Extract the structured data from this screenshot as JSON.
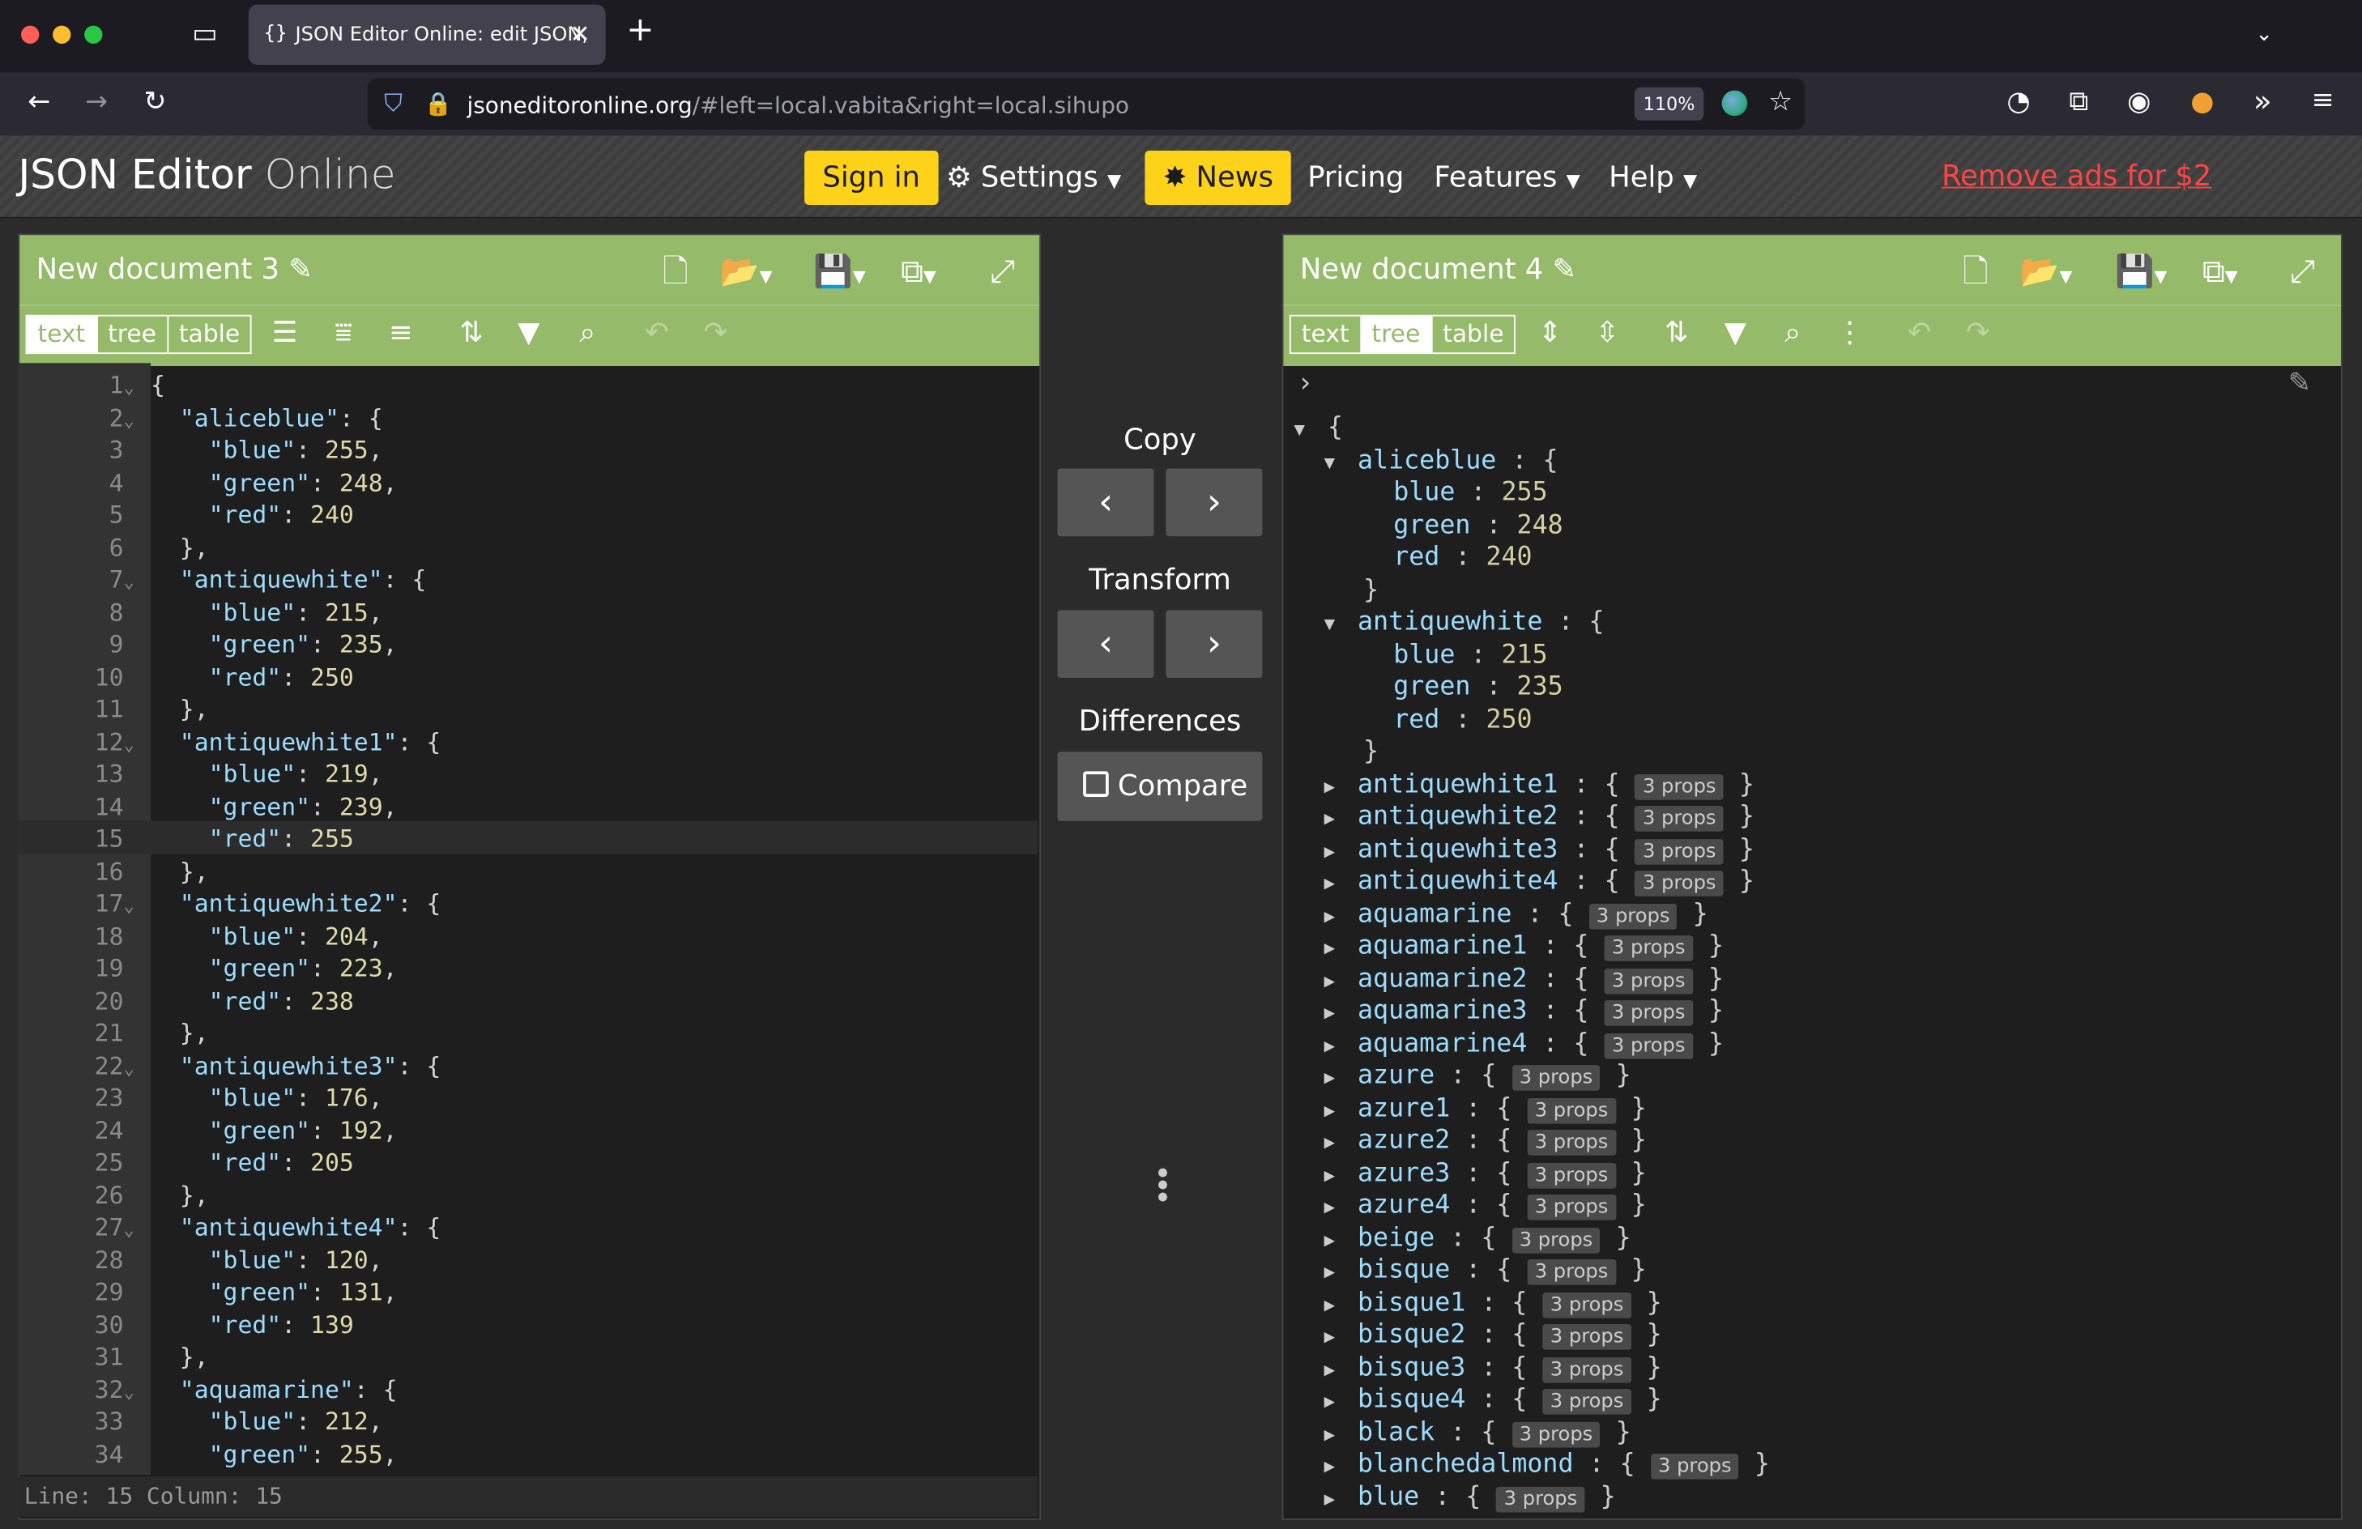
{
  "browser": {
    "tab_title": "JSON Editor Online: edit JSON,",
    "url_main": "jsoneditoronline.org",
    "url_rest": "/#left=local.vabita&right=local.sihupo",
    "zoom": "110%"
  },
  "header": {
    "logo_main": "JSON Editor",
    "logo_sub": "Online",
    "sign_in": "Sign in",
    "settings": "Settings",
    "news": "News",
    "pricing": "Pricing",
    "features": "Features",
    "help": "Help",
    "remove_ads": "Remove ads for $2"
  },
  "left_panel": {
    "title": "New document 3",
    "modes": [
      "text",
      "tree",
      "table"
    ],
    "active_mode": "text",
    "status": "Line: 15  Column: 15",
    "lines": [
      {
        "n": "1",
        "ind": 0,
        "open": "{",
        "fold": true
      },
      {
        "n": "2",
        "ind": 1,
        "key": "aliceblue",
        "open": "{",
        "fold": true
      },
      {
        "n": "3",
        "ind": 2,
        "key": "blue",
        "val": "255",
        "comma": true
      },
      {
        "n": "4",
        "ind": 2,
        "key": "green",
        "val": "248",
        "comma": true
      },
      {
        "n": "5",
        "ind": 2,
        "key": "red",
        "val": "240"
      },
      {
        "n": "6",
        "ind": 1,
        "close": "},"
      },
      {
        "n": "7",
        "ind": 1,
        "key": "antiquewhite",
        "open": "{",
        "fold": true
      },
      {
        "n": "8",
        "ind": 2,
        "key": "blue",
        "val": "215",
        "comma": true
      },
      {
        "n": "9",
        "ind": 2,
        "key": "green",
        "val": "235",
        "comma": true
      },
      {
        "n": "10",
        "ind": 2,
        "key": "red",
        "val": "250"
      },
      {
        "n": "11",
        "ind": 1,
        "close": "},"
      },
      {
        "n": "12",
        "ind": 1,
        "key": "antiquewhite1",
        "open": "{",
        "fold": true
      },
      {
        "n": "13",
        "ind": 2,
        "key": "blue",
        "val": "219",
        "comma": true
      },
      {
        "n": "14",
        "ind": 2,
        "key": "green",
        "val": "239",
        "comma": true
      },
      {
        "n": "15",
        "ind": 2,
        "key": "red",
        "val": "255",
        "active": true
      },
      {
        "n": "16",
        "ind": 1,
        "close": "},"
      },
      {
        "n": "17",
        "ind": 1,
        "key": "antiquewhite2",
        "open": "{",
        "fold": true
      },
      {
        "n": "18",
        "ind": 2,
        "key": "blue",
        "val": "204",
        "comma": true
      },
      {
        "n": "19",
        "ind": 2,
        "key": "green",
        "val": "223",
        "comma": true
      },
      {
        "n": "20",
        "ind": 2,
        "key": "red",
        "val": "238"
      },
      {
        "n": "21",
        "ind": 1,
        "close": "},"
      },
      {
        "n": "22",
        "ind": 1,
        "key": "antiquewhite3",
        "open": "{",
        "fold": true
      },
      {
        "n": "23",
        "ind": 2,
        "key": "blue",
        "val": "176",
        "comma": true
      },
      {
        "n": "24",
        "ind": 2,
        "key": "green",
        "val": "192",
        "comma": true
      },
      {
        "n": "25",
        "ind": 2,
        "key": "red",
        "val": "205"
      },
      {
        "n": "26",
        "ind": 1,
        "close": "},"
      },
      {
        "n": "27",
        "ind": 1,
        "key": "antiquewhite4",
        "open": "{",
        "fold": true
      },
      {
        "n": "28",
        "ind": 2,
        "key": "blue",
        "val": "120",
        "comma": true
      },
      {
        "n": "29",
        "ind": 2,
        "key": "green",
        "val": "131",
        "comma": true
      },
      {
        "n": "30",
        "ind": 2,
        "key": "red",
        "val": "139"
      },
      {
        "n": "31",
        "ind": 1,
        "close": "},"
      },
      {
        "n": "32",
        "ind": 1,
        "key": "aquamarine",
        "open": "{",
        "fold": true
      },
      {
        "n": "33",
        "ind": 2,
        "key": "blue",
        "val": "212",
        "comma": true
      },
      {
        "n": "34",
        "ind": 2,
        "key": "green",
        "val": "255",
        "comma": true
      }
    ]
  },
  "middle": {
    "copy": "Copy",
    "transform": "Transform",
    "differences": "Differences",
    "compare": "Compare"
  },
  "right_panel": {
    "title": "New document 4",
    "modes": [
      "text",
      "tree",
      "table"
    ],
    "active_mode": "tree",
    "expanded": [
      {
        "key": "aliceblue",
        "props": [
          [
            "blue",
            "255"
          ],
          [
            "green",
            "248"
          ],
          [
            "red",
            "240"
          ]
        ]
      },
      {
        "key": "antiquewhite",
        "props": [
          [
            "blue",
            "215"
          ],
          [
            "green",
            "235"
          ],
          [
            "red",
            "250"
          ]
        ]
      }
    ],
    "collapsed": [
      "antiquewhite1",
      "antiquewhite2",
      "antiquewhite3",
      "antiquewhite4",
      "aquamarine",
      "aquamarine1",
      "aquamarine2",
      "aquamarine3",
      "aquamarine4",
      "azure",
      "azure1",
      "azure2",
      "azure3",
      "azure4",
      "beige",
      "bisque",
      "bisque1",
      "bisque2",
      "bisque3",
      "bisque4",
      "black",
      "blanchedalmond",
      "blue"
    ],
    "props_label": "3 props"
  }
}
